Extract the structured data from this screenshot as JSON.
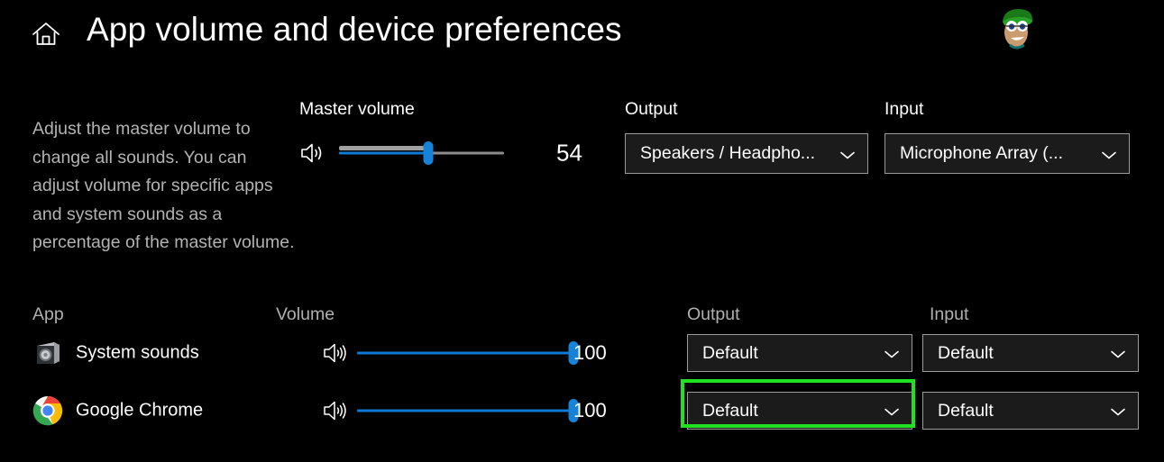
{
  "header": {
    "home_icon": "home-icon",
    "title": "App volume and device preferences",
    "watermark": "appuals-mascot-logo"
  },
  "description": "Adjust the master volume to change all sounds. You can adjust volume for specific apps and system sounds as a percentage of the master volume.",
  "master": {
    "label": "Master volume",
    "value": "54",
    "percent": 54,
    "speaker_icon": "speaker-volume-icon"
  },
  "top_devices": {
    "output": {
      "label": "Output",
      "value": "Speakers / Headpho...",
      "chevron_icon": "chevron-down-icon"
    },
    "input": {
      "label": "Input",
      "value": "Microphone Array (...",
      "chevron_icon": "chevron-down-icon"
    }
  },
  "app_table": {
    "headers": {
      "app": "App",
      "volume": "Volume",
      "output": "Output",
      "input": "Input"
    },
    "rows": [
      {
        "name": "System sounds",
        "icon": "system-sounds-speaker-icon",
        "volume": "100",
        "percent": 100,
        "speaker_icon": "speaker-volume-icon",
        "output": "Default",
        "input": "Default",
        "chevron_icon": "chevron-down-icon"
      },
      {
        "name": "Google Chrome",
        "icon": "google-chrome-icon",
        "volume": "100",
        "percent": 100,
        "speaker_icon": "speaker-volume-icon",
        "output": "Default",
        "input": "Default",
        "chevron_icon": "chevron-down-icon"
      }
    ]
  },
  "annotation": {
    "highlight_color": "#22e022",
    "target": "google-chrome-output-dropdown"
  },
  "colors": {
    "background": "#000000",
    "accent_blue": "#0f7ad6",
    "text_primary": "#ffffff",
    "text_secondary": "#b3b3b3",
    "border": "#9b9b9b"
  }
}
